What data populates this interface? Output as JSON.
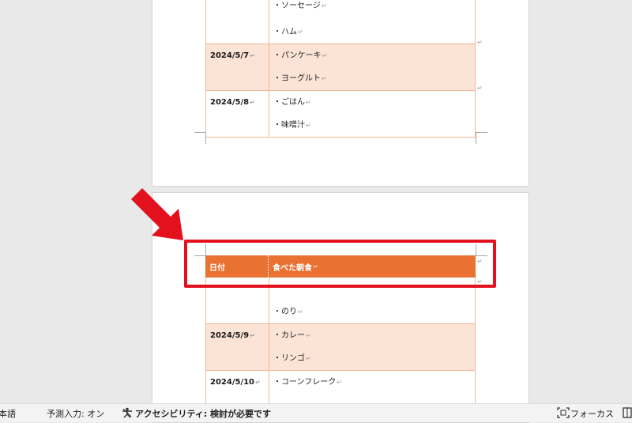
{
  "page1": {
    "rows": [
      {
        "date": "",
        "items": [
          "・ソーセージ",
          "・ハム"
        ],
        "shaded": false
      },
      {
        "date": "2024/5/7",
        "items": [
          "・パンケーキ",
          "・ヨーグルト"
        ],
        "shaded": true
      },
      {
        "date": "2024/5/8",
        "items": [
          "・ごはん",
          "・味噌汁"
        ],
        "shaded": false
      }
    ]
  },
  "page2": {
    "header": {
      "col1": "日付",
      "col2": "食べた朝食"
    },
    "rows": [
      {
        "date": "",
        "items": [
          "",
          "・のり"
        ],
        "shaded": false
      },
      {
        "date": "2024/5/9",
        "items": [
          "・カレー",
          "・リンゴ"
        ],
        "shaded": true
      },
      {
        "date": "2024/5/10",
        "items": [
          "・コーンフレーク",
          ""
        ],
        "shaded": false
      }
    ]
  },
  "status_bar": {
    "language": "本語",
    "predictive_input": "予測入力: オン",
    "accessibility": "アクセシビリティ: 検討が必要です",
    "focus": "フォーカス"
  },
  "colors": {
    "header_fill": "#e97132",
    "shade_fill": "#fbe3d6",
    "highlight": "#e3101e",
    "arrow": "#e3101e"
  }
}
